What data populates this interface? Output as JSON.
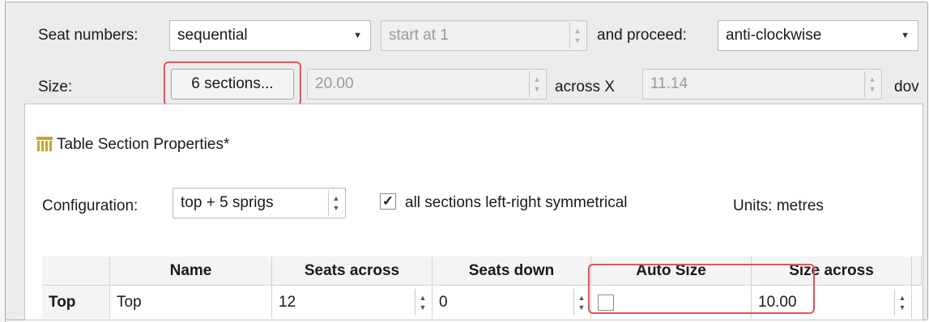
{
  "toolbar": {
    "seat_numbers_label": "Seat numbers:",
    "seat_numbers_value": "sequential",
    "start_at_value": "start at 1",
    "proceed_label": "and proceed:",
    "proceed_value": "anti-clockwise",
    "size_label": "Size:",
    "sections_button": "6 sections...",
    "size_across_value": "20.00",
    "across_label": "across X",
    "size_down_value": "11.14",
    "down_label_partial": "dov"
  },
  "dialog": {
    "title": "Table Section Properties*",
    "configuration_label": "Configuration:",
    "configuration_value": "top + 5 sprigs",
    "symmetry_label": "all sections left-right symmetrical",
    "symmetry_checked": true,
    "units_label": "Units: metres"
  },
  "table": {
    "headers": [
      "Name",
      "Seats across",
      "Seats down",
      "Auto Size",
      "Size across"
    ],
    "rows": [
      {
        "row_header": "Top",
        "name": "Top",
        "seats_across": "12",
        "seats_down": "0",
        "auto_size": false,
        "size_across": "10.00"
      }
    ]
  },
  "colors": {
    "highlight": "#e8515a",
    "dialog_icon": "#c8a23c"
  },
  "icons": [
    "dropdown-arrow-icon",
    "spin-up-down-icon",
    "table-sections-icon",
    "checkmark-icon"
  ]
}
